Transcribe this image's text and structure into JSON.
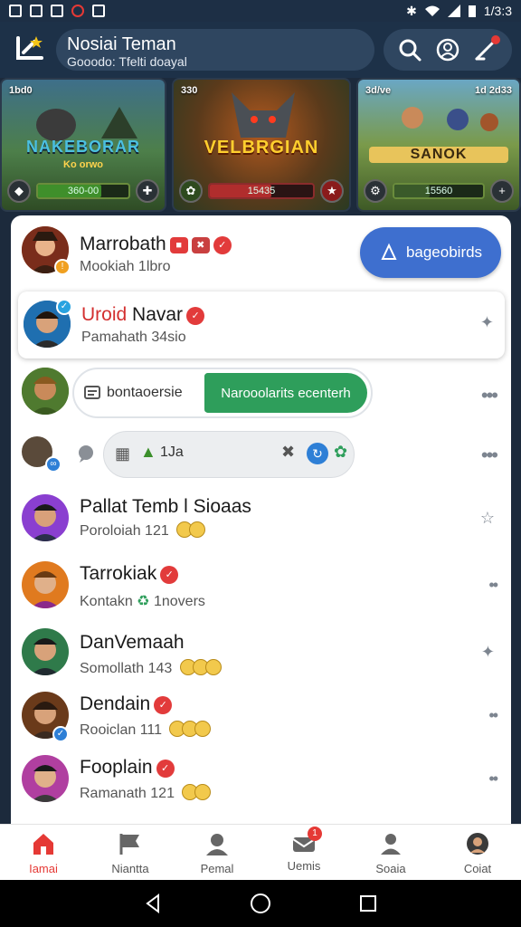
{
  "status_bar": {
    "time": "1/3:3"
  },
  "header": {
    "title": "Nosiai Teman",
    "subtitle": "Gooodo: Tfelti doayal"
  },
  "banners": [
    {
      "name": "NAKEBORAR",
      "tag": "Ko orwo",
      "stat_left": "1bd0",
      "bar": "360-00"
    },
    {
      "name": "VELBRGIAN",
      "tag": "",
      "stat_left": "330",
      "bar": "15435"
    },
    {
      "name": "SANOK",
      "tag": "",
      "stat_left": "3d/ve",
      "stat_right": "1d 2d33",
      "bar": "15560"
    }
  ],
  "list": {
    "top_row": {
      "name": "Marrobath",
      "sub": "Mookiah  1lbro",
      "button": "bageobirds"
    },
    "card_row": {
      "name_red": "Uroid",
      "name": "Navar",
      "sub": "Pamahath  34sio"
    },
    "action_row": {
      "label": "bontaoersie",
      "action": "Narooolarits ecenterh"
    },
    "compose_row": {
      "text": "1Ja"
    },
    "friends": [
      {
        "name": "Pallat Temb l Sioaas",
        "sub": "Poroloiah 121"
      },
      {
        "name": "Tarrokiak",
        "sub": "Kontakn",
        "sub2": "1novers"
      },
      {
        "name": "DanVemaah",
        "sub": "Somollath 143"
      },
      {
        "name": "Dendain",
        "sub": "Rooiclan 111"
      },
      {
        "name": "Fooplain",
        "sub": "Ramanath 121"
      }
    ]
  },
  "bottom_nav": [
    {
      "label": "Iamai",
      "active": true
    },
    {
      "label": "Niantta"
    },
    {
      "label": "Pemal"
    },
    {
      "label": "Uemis",
      "badge": "1"
    },
    {
      "label": "Soaia"
    },
    {
      "label": "Coiat"
    }
  ],
  "colors": {
    "accent": "#e53935",
    "primary_button": "#3e6fcf",
    "action_green": "#2e9e5b",
    "header_bg": "#1d3148"
  }
}
